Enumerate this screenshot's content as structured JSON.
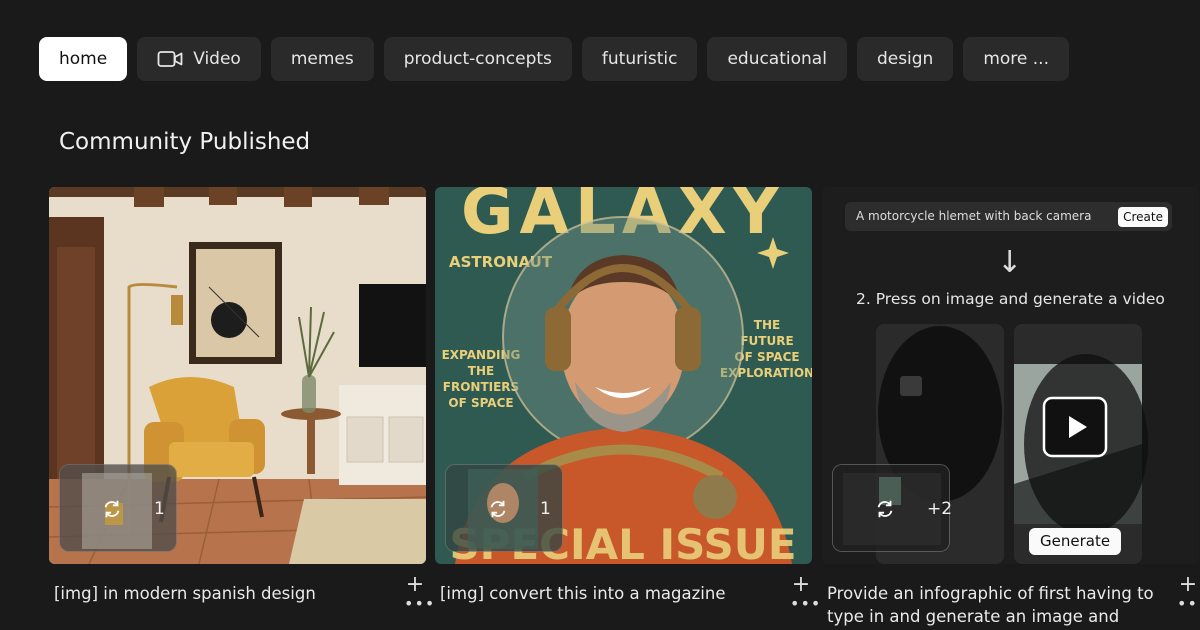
{
  "tabs": [
    {
      "label": "home",
      "active": true
    },
    {
      "label": "Video",
      "icon": "video-camera-icon"
    },
    {
      "label": "memes"
    },
    {
      "label": "product-concepts"
    },
    {
      "label": "futuristic"
    },
    {
      "label": "educational"
    },
    {
      "label": "design"
    },
    {
      "label": "more ..."
    }
  ],
  "section_title": "Community Published",
  "cards": [
    {
      "caption": "[img] in modern spanish design",
      "variant_count": "1",
      "icons": [
        "swap-icon",
        "plus-icon",
        "more-icon"
      ]
    },
    {
      "caption": "[img] convert this into a magazine",
      "variant_count": "1",
      "magazine": {
        "masthead": "GALAXY",
        "label_top": "ASTRONAUT",
        "left_text": [
          "EXPANDING",
          "THE",
          "FRONTIERS",
          "OF SPACE"
        ],
        "right_text": [
          "THE",
          "FUTURE",
          "OF SPACE",
          "EXPLORATION"
        ],
        "footer": "SPECIAL ISSUE"
      }
    },
    {
      "caption": "Provide an infographic of first having to type in and generate an image and the...",
      "variant_count": "+2",
      "infographic": {
        "prompt": "A motorcycle hlemet with back camera",
        "create_label": "Create",
        "step_text": "2. Press on image and generate a video",
        "generate_label": "Generate"
      }
    }
  ],
  "colors": {
    "background": "#1a1a1a",
    "tab_bg": "#2a2a2a",
    "tab_active_bg": "#ffffff",
    "magazine_gold": "#e9cf7a",
    "magazine_teal": "#2f5a52",
    "suit_orange": "#c8572a"
  }
}
